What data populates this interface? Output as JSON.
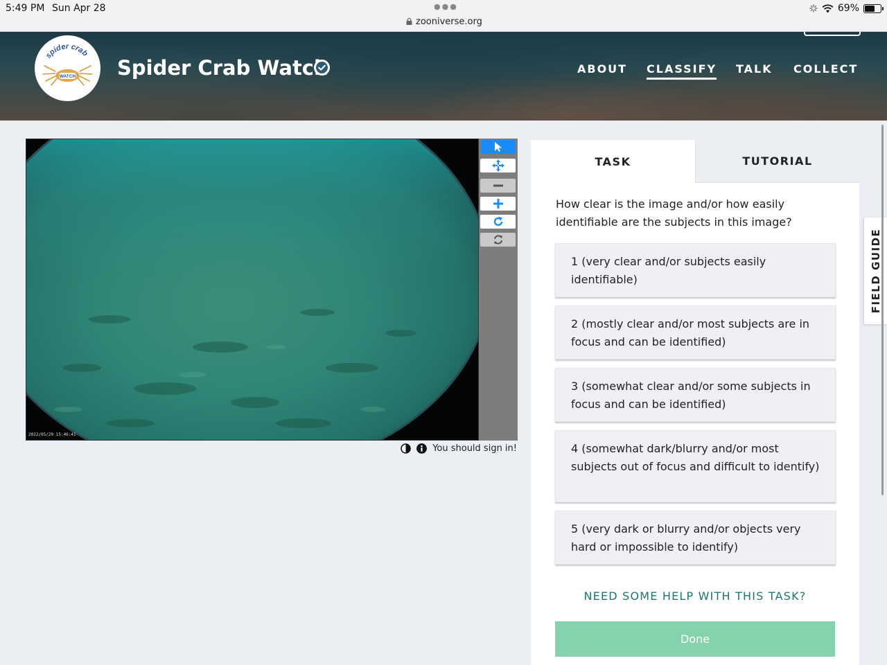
{
  "status_bar": {
    "time": "5:49 PM",
    "date": "Sun Apr 28",
    "url": "zooniverse.org",
    "battery": "69%",
    "battery_level": 0.69,
    "icons": [
      "activity-spinner-icon",
      "wifi-icon",
      "battery-icon",
      "lock-icon"
    ]
  },
  "header": {
    "logo_text": "spider crab",
    "logo_subtext": "WATCH",
    "title": "Spider Crab Watch",
    "nav": {
      "about": "ABOUT",
      "classify": "CLASSIFY",
      "talk": "TALK",
      "collect": "COLLECT"
    },
    "active_nav": "classify"
  },
  "viewer": {
    "timestamp": "2022/05/20 15:46:41",
    "tools": [
      "pointer-icon",
      "pan-icon",
      "zoom-out-icon",
      "zoom-in-icon",
      "rotate-icon",
      "reset-icon"
    ],
    "sign_in_note": "You should sign in!"
  },
  "panel": {
    "tabs": {
      "task": "TASK",
      "tutorial": "TUTORIAL"
    },
    "question": "How clear is the image and/or how easily identifiable are the subjects in this image?",
    "answers": [
      "1 (very clear and/or subjects easily identifiable)",
      "2 (mostly clear and/or most subjects are in focus and can be identified)",
      "3 (somewhat clear and/or some subjects in focus and can be identified)",
      "4 (somewhat dark/blurry and/or most subjects out of focus and difficult to identify)",
      "5 (very dark or blurry and/or objects very hard or impossible to identify)"
    ],
    "help": "NEED SOME HELP WITH THIS TASK?",
    "done": "Done"
  },
  "field_guide": "FIELD GUIDE",
  "colors": {
    "accent_blue": "#1a8cff",
    "done_green": "#84d3ad",
    "help_teal": "#1e7472",
    "water": "#2a8a7c"
  }
}
